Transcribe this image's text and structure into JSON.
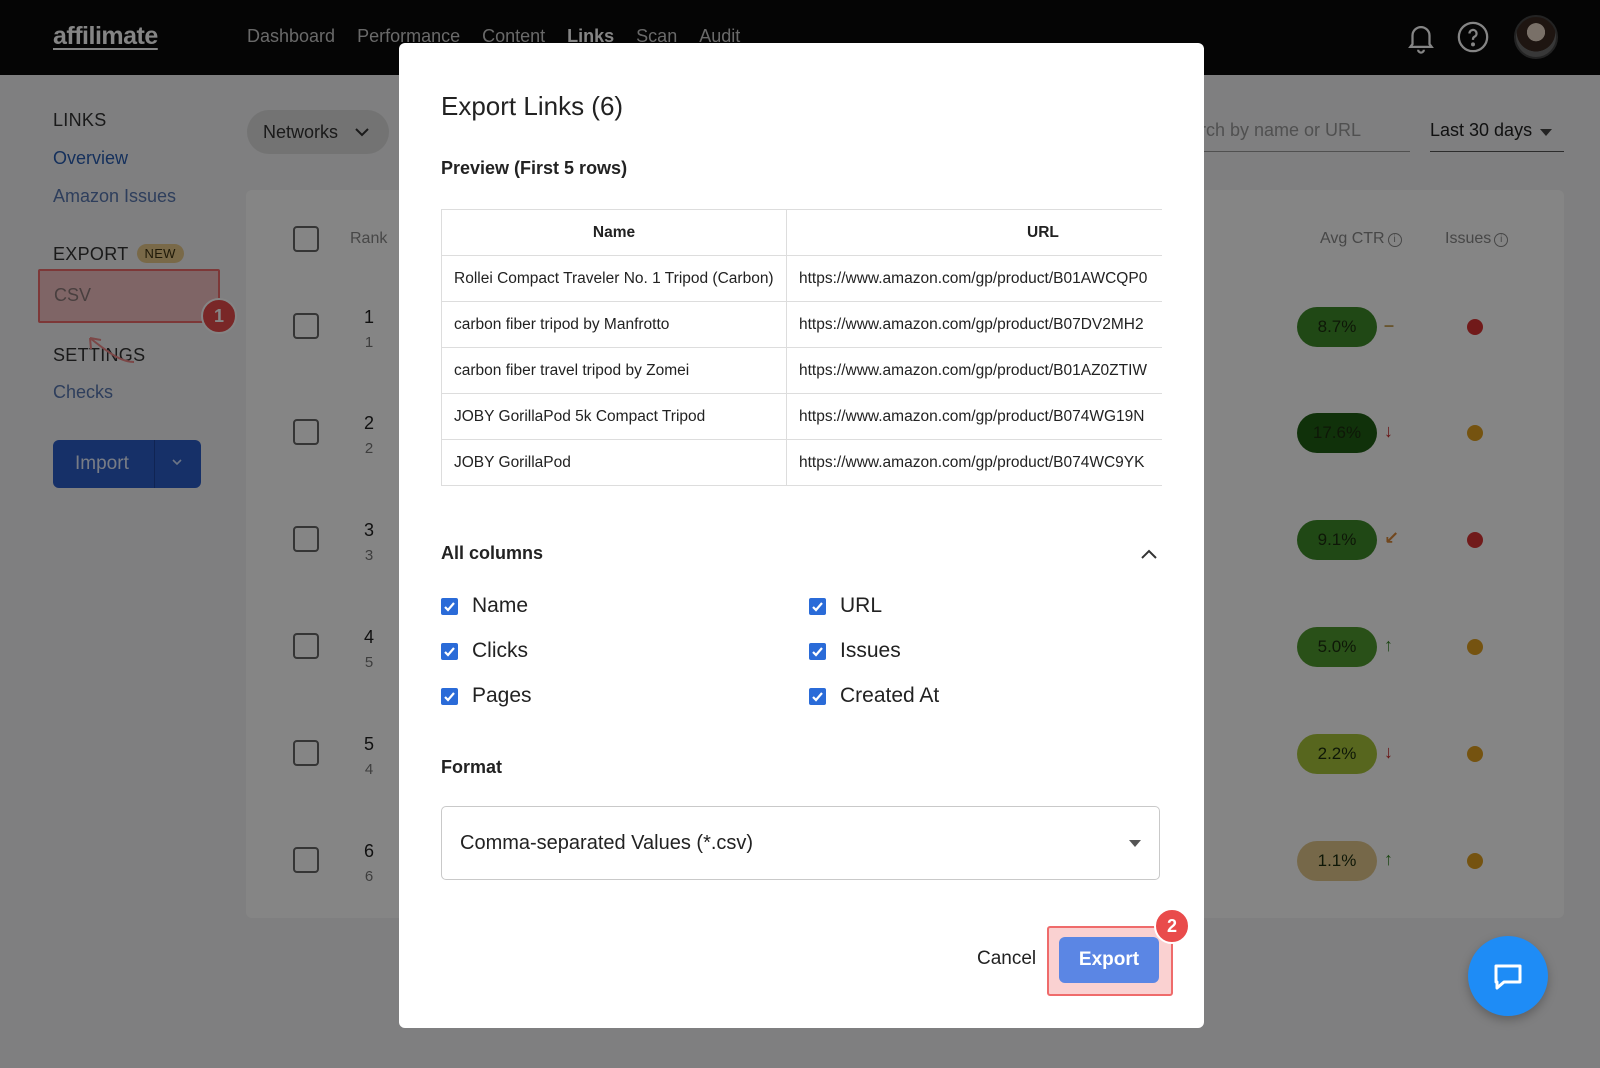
{
  "app": {
    "logo": "affilimate",
    "nav": [
      "Dashboard",
      "Performance",
      "Content",
      "Links",
      "Scan",
      "Audit"
    ],
    "active_nav": "Links"
  },
  "sidebar": {
    "links_heading": "LINKS",
    "links_items": [
      "Overview",
      "Amazon Issues"
    ],
    "export_heading": "EXPORT",
    "export_badge": "NEW",
    "export_items": [
      "CSV"
    ],
    "settings_heading": "SETTINGS",
    "settings_items": [
      "Checks"
    ],
    "import_label": "Import"
  },
  "toolbar": {
    "networks_label": "Networks",
    "search_placeholder": "rch by name or URL",
    "date_range": "Last 30 days"
  },
  "table": {
    "headers": {
      "rank": "Rank",
      "avg_ctr": "Avg CTR",
      "issues": "Issues"
    },
    "rows": [
      {
        "rank": "1",
        "prev_rank": "1",
        "ctr": "8.7%",
        "ctr_color": "#3e8a2a",
        "trend": "–",
        "trend_color": "#c7a35a",
        "issue_color": "#d93333"
      },
      {
        "rank": "2",
        "prev_rank": "2",
        "ctr": "17.6%",
        "ctr_color": "#1f5f15",
        "trend": "↓",
        "trend_color": "#c72b2b",
        "issue_color": "#e0a020"
      },
      {
        "rank": "3",
        "prev_rank": "3",
        "ctr": "9.1%",
        "ctr_color": "#3e8a2a",
        "trend": "↙",
        "trend_color": "#d9893a",
        "issue_color": "#d93333"
      },
      {
        "rank": "4",
        "prev_rank": "5",
        "ctr": "5.0%",
        "ctr_color": "#4f9a2e",
        "trend": "↑",
        "trend_color": "#3a8a2a",
        "issue_color": "#e0a020"
      },
      {
        "rank": "5",
        "prev_rank": "4",
        "ctr": "2.2%",
        "ctr_color": "#a8c43a",
        "trend": "↓",
        "trend_color": "#c72b2b",
        "issue_color": "#e0a020"
      },
      {
        "rank": "6",
        "prev_rank": "6",
        "ctr": "1.1%",
        "ctr_color": "#e3c88c",
        "trend": "↑",
        "trend_color": "#3a8a2a",
        "issue_color": "#e0a020"
      }
    ]
  },
  "modal": {
    "title": "Export Links (6)",
    "preview_title": "Preview (First 5 rows)",
    "preview_headers": [
      "Name",
      "URL"
    ],
    "preview_rows": [
      [
        "Rollei Compact Traveler No. 1 Tripod (Carbon)",
        "https://www.amazon.com/gp/product/B01AWCQP0"
      ],
      [
        "carbon fiber tripod by Manfrotto",
        "https://www.amazon.com/gp/product/B07DV2MH2"
      ],
      [
        "carbon fiber travel tripod by Zomei",
        "https://www.amazon.com/gp/product/B01AZ0ZTIW"
      ],
      [
        "JOBY GorillaPod 5k Compact Tripod",
        "https://www.amazon.com/gp/product/B074WG19N"
      ],
      [
        "JOBY GorillaPod",
        "https://www.amazon.com/gp/product/B074WC9YK"
      ]
    ],
    "columns_title": "All columns",
    "columns": [
      "Name",
      "URL",
      "Clicks",
      "Issues",
      "Pages",
      "Created At"
    ],
    "format_title": "Format",
    "format_value": "Comma-separated Values (*.csv)",
    "cancel_label": "Cancel",
    "export_label": "Export"
  },
  "annotations": {
    "step1": "1",
    "step2": "2"
  },
  "colors": {
    "accent": "#2a6bd8",
    "highlight": "#ef6b6b",
    "topbar": "#0b0b0b"
  },
  "icons": [
    "bell-icon",
    "help-icon",
    "chevron-down-icon",
    "chevron-up-icon",
    "check-icon",
    "chat-icon",
    "curved-arrow-icon"
  ]
}
